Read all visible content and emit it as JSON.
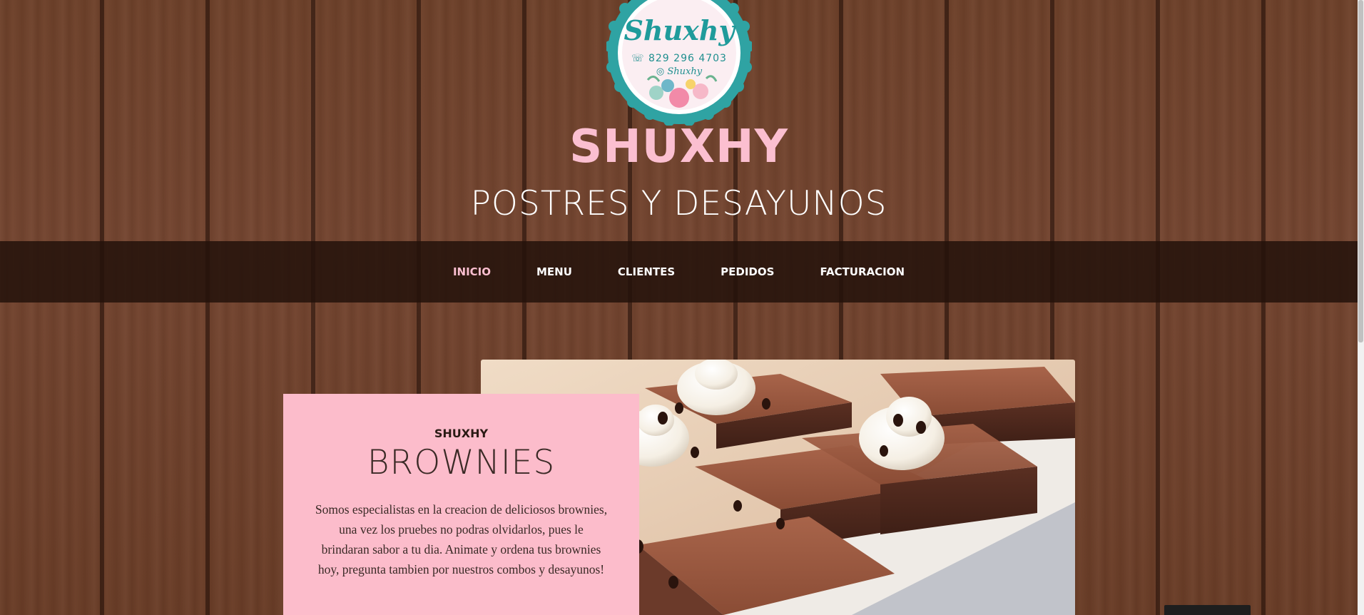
{
  "header": {
    "logo": {
      "script_name": "Shuxhy",
      "phone": "829 296 4703",
      "instagram": "Shuxhy",
      "ring_color": "#2fa3a3",
      "badge_color": "#fbeef2"
    },
    "title": "SHUXHY",
    "subtitle": "POSTRES Y DESAYUNOS"
  },
  "nav": {
    "items": [
      {
        "label": "INICIO",
        "active": true
      },
      {
        "label": "MENU",
        "active": false
      },
      {
        "label": "CLIENTES",
        "active": false
      },
      {
        "label": "PEDIDOS",
        "active": false
      },
      {
        "label": "FACTURACION",
        "active": false
      }
    ]
  },
  "intro": {
    "kicker": "SHUXHY",
    "title": "BROWNIES",
    "text": "Somos especialistas en la creacion de deliciosos brownies, una vez los pruebes no podras olvidarlos, pues le brindaran sabor a tu dia. Animate y ordena tus brownies hoy, pregunta tambien por nuestros combos y desayunos!"
  },
  "colors": {
    "accent_pink": "#fbbfd0",
    "card_pink": "#fcbccb",
    "navbar_bg": "#23120a",
    "wood": "#6e412a"
  }
}
